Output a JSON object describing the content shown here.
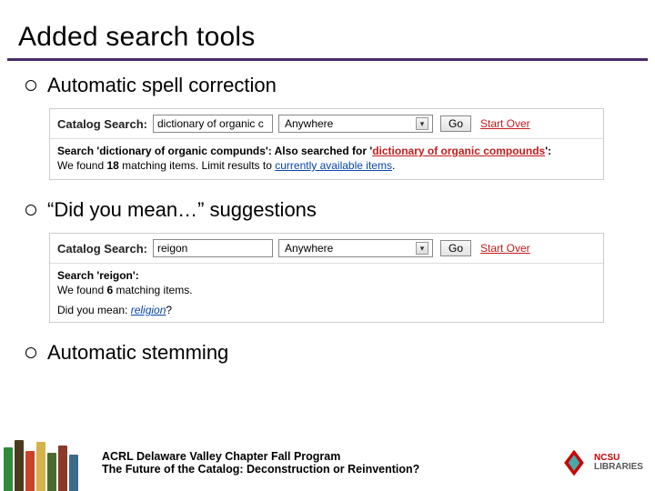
{
  "title": "Added search tools",
  "bullets": {
    "b1": "Automatic spell correction",
    "b2": "“Did you mean…” suggestions",
    "b3": "Automatic stemming"
  },
  "shot1": {
    "label": "Catalog Search:",
    "query": "dictionary of organic c",
    "scope": "Anywhere",
    "go": "Go",
    "startOver": "Start Over",
    "searchFor_prefix": "Search '",
    "searchFor_term": "dictionary of organic compunds",
    "searchFor_suffix": "': Also searched for '",
    "corrected": "dictionary of organic compounds",
    "after_corrected": "':",
    "found_prefix": "We found ",
    "found_count": "18",
    "found_mid": " matching items. Limit results to ",
    "limit_link": "currently available items",
    "found_end": "."
  },
  "shot2": {
    "label": "Catalog Search:",
    "query": "reigon",
    "scope": "Anywhere",
    "go": "Go",
    "startOver": "Start Over",
    "searchFor_prefix": "Search '",
    "searchFor_term": "reigon",
    "searchFor_suffix": "':",
    "found_prefix": "We found ",
    "found_count": "6",
    "found_suffix": " matching items.",
    "dym_prefix": "Did you mean: ",
    "dym_link": "religion",
    "dym_end": "?"
  },
  "footer": {
    "line1": "ACRL Delaware Valley Chapter Fall Program",
    "line2": "The Future of the Catalog: Deconstruction or Reinvention?",
    "logo1": "NCSU",
    "logo2": "LIBRARIES"
  }
}
